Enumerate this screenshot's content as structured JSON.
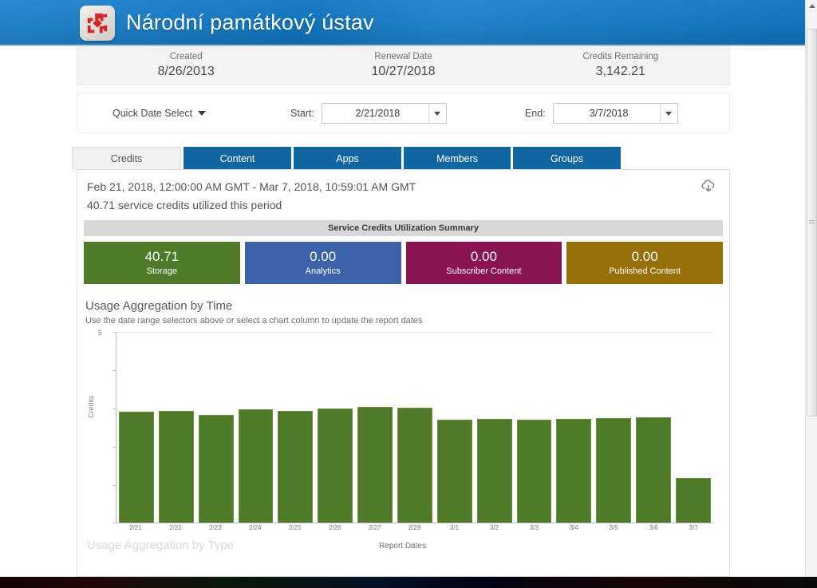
{
  "header": {
    "title": "Národní památkový ústav",
    "logo_icon": "npu-pinwheel-logo",
    "background_color": "#1379c4"
  },
  "summary": {
    "cells": [
      {
        "label": "Created",
        "value": "8/26/2013"
      },
      {
        "label": "Renewal Date",
        "value": "10/27/2018"
      },
      {
        "label": "Credits Remaining",
        "value": "3,142.21"
      }
    ]
  },
  "date_bar": {
    "quick_date_label": "Quick Date Select",
    "quick_date_icon": "chevron-down-icon",
    "start_label": "Start:",
    "start_value": "2/21/2018",
    "end_label": "End:",
    "end_value": "3/7/2018",
    "dropdown_icon": "chevron-down-icon"
  },
  "tabs": [
    {
      "label": "Credits",
      "active": true
    },
    {
      "label": "Content",
      "active": false
    },
    {
      "label": "Apps",
      "active": false
    },
    {
      "label": "Members",
      "active": false
    },
    {
      "label": "Groups",
      "active": false
    }
  ],
  "report": {
    "range_line": "Feb 21, 2018, 12:00:00 AM GMT - Mar 7, 2018, 10:59:01 AM GMT",
    "credits_line": "40.71 service credits utilized this period",
    "download_icon": "cloud-download-icon",
    "section_title": "Service Credits Utilization Summary",
    "kpis": [
      {
        "value": "40.71",
        "label": "Storage",
        "color": "#4f7a28"
      },
      {
        "value": "0.00",
        "label": "Analytics",
        "color": "#3c62aa"
      },
      {
        "value": "0.00",
        "label": "Subscriber Content",
        "color": "#8c1452"
      },
      {
        "value": "0.00",
        "label": "Published Content",
        "color": "#97700a"
      }
    ],
    "next_section_title": "Usage Aggregation by Type"
  },
  "chart_data": {
    "type": "bar",
    "title": "Usage Aggregation by Time",
    "subtitle": "Use the date range selectors above or select a chart column to update the report dates",
    "xlabel": "Report Dates",
    "ylabel": "Credits",
    "ylim": [
      0,
      5
    ],
    "ytick_labels": [
      "5"
    ],
    "grid": false,
    "legend": null,
    "series_color": "#4f7a28",
    "categories": [
      "2/21",
      "2/22",
      "2/23",
      "2/24",
      "2/25",
      "2/26",
      "2/27",
      "2/28",
      "3/1",
      "3/2",
      "3/3",
      "3/4",
      "3/5",
      "3/6",
      "3/7"
    ],
    "values": [
      2.9,
      2.93,
      2.82,
      2.97,
      2.93,
      3.0,
      3.04,
      3.02,
      2.7,
      2.71,
      2.7,
      2.71,
      2.74,
      2.77,
      1.18
    ]
  },
  "scrollbar": {
    "up_icon": "scroll-up-arrow-icon",
    "down_icon": "scroll-down-arrow-icon",
    "thumb": "scrollbar-thumb"
  }
}
